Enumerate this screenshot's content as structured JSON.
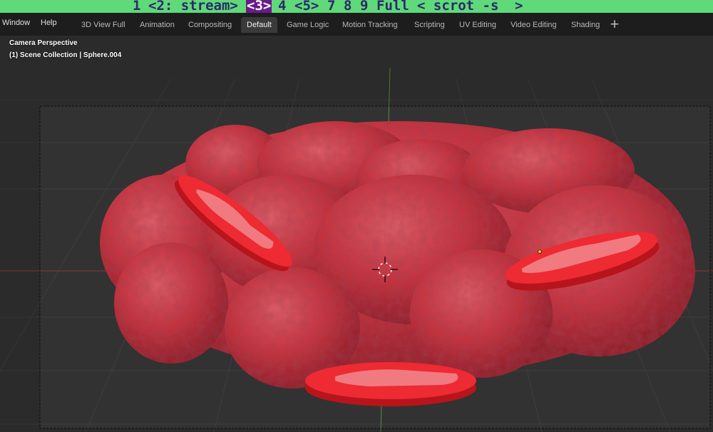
{
  "wm_bar": {
    "workspaces": [
      {
        "label": "1",
        "active": false
      },
      {
        "label": "<2: stream>",
        "active": false
      },
      {
        "label": "<3>",
        "active": true
      },
      {
        "label": "4",
        "active": false
      },
      {
        "label": "<5>",
        "active": false
      },
      {
        "label": "7",
        "active": false
      },
      {
        "label": "8",
        "active": false
      },
      {
        "label": "9",
        "active": false
      },
      {
        "label": "Full",
        "active": false
      },
      {
        "label": "< scrot -s",
        "active": false
      },
      {
        "label": ">",
        "active": false
      }
    ],
    "bg_color": "#5fd97a",
    "active_color": "#6a1a8a"
  },
  "header": {
    "menus": [
      "Window",
      "Help"
    ],
    "tabs": [
      {
        "label": "3D View Full",
        "active": false
      },
      {
        "label": "Animation",
        "active": false
      },
      {
        "label": "Compositing",
        "active": false
      },
      {
        "label": "Default",
        "active": true
      },
      {
        "label": "Game Logic",
        "active": false
      },
      {
        "label": "Motion Tracking",
        "active": false
      },
      {
        "label": "Scripting",
        "active": false
      },
      {
        "label": "UV Editing",
        "active": false
      },
      {
        "label": "Video Editing",
        "active": false
      },
      {
        "label": "Shading",
        "active": false
      }
    ],
    "add_tab_label": "+"
  },
  "viewport": {
    "view_label": "Camera Perspective",
    "collection_label": "(1) Scene Collection | Sphere.004",
    "model_color": "#c8323c",
    "accent_red": "#e8262e"
  }
}
